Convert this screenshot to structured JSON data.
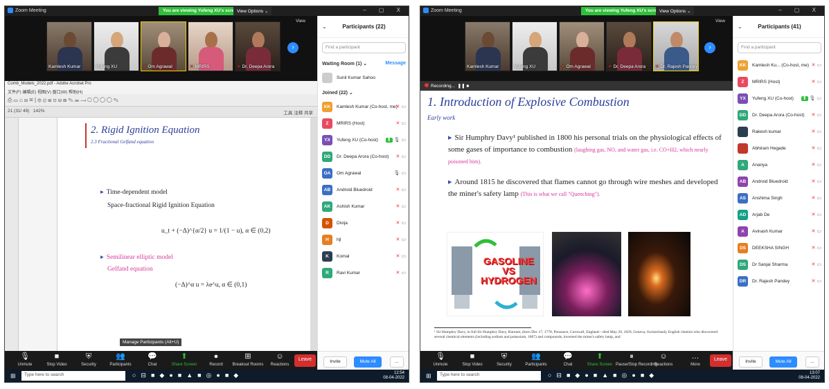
{
  "left": {
    "title": "Zoom Meeting",
    "viewing_banner": "You are viewing Yufeng XU's screen",
    "view_options": "View Options ⌄",
    "view_label": "View",
    "gallery": [
      {
        "name": "Kamlesh Kumar",
        "muted": false
      },
      {
        "name": "Yufeng XU",
        "muted": false
      },
      {
        "name": "Om Agrawal",
        "muted": true
      },
      {
        "name": "MRIRS",
        "muted": true
      },
      {
        "name": "Dr. Deepa Arora",
        "muted": true
      }
    ],
    "acrobat": {
      "title": "Comb_Models_2022.pdf - Adobe Acrobat Pro",
      "menu": "文件(F) 编辑(E) 视图(V) 窗口(W) 帮助(H)",
      "page_status": "21 (31/ 49)",
      "zoom": "142%",
      "right_tools": "工具  注释  共享"
    },
    "document": {
      "heading": "2. Rigid Ignition Equation",
      "subheading": "2.3 Fractional Gelfand equation",
      "bullet1": "Time-dependent model",
      "bullet1_sub": "Space-fractional Rigid Ignition Equation",
      "eq1": "u_t + (−Δ)^{α/2} u = 1/(1 − u),  α ∈ (0,2)",
      "bullet2": "Semilinear elliptic model",
      "bullet2_sub": "Gelfand equation",
      "eq2": "(−Δ)^α u = λe^u,  α ∈ (0,1)"
    },
    "participants": {
      "title": "Participants (22)",
      "search_placeholder": "Find a participant",
      "waiting_header": "Waiting Room (1)  ⌄",
      "waiting_action": "Message",
      "waiting": [
        {
          "initials": "",
          "name": "Sunil Kumar Sahoo",
          "color": "#cccccc"
        }
      ],
      "joined_header": "Joined (22)  ⌄",
      "joined": [
        {
          "initials": "KK",
          "name": "Kamlesh Kumar (Co-host, me)",
          "color": "#f0a030",
          "status": "muted"
        },
        {
          "initials": "Z",
          "name": "MRIRS (Host)",
          "color": "#e84a5f",
          "status": "muted"
        },
        {
          "initials": "YX",
          "name": "Yufeng XU (Co-host)",
          "color": "#7a4fb5",
          "status": "sharing"
        },
        {
          "initials": "DD",
          "name": "Dr. Deepa Arora (Co-host)",
          "color": "#2fa87a",
          "status": "muted"
        },
        {
          "initials": "OA",
          "name": "Om Agrawal",
          "color": "#3a6fc4",
          "status": "unmuted"
        },
        {
          "initials": "AB",
          "name": "Android Bluedroid",
          "color": "#3a6fc4",
          "status": "muted"
        },
        {
          "initials": "AK",
          "name": "Ashish Kumar",
          "color": "#2fa87a",
          "status": "muted"
        },
        {
          "initials": "D",
          "name": "Divija",
          "color": "#d35400",
          "status": "muted"
        },
        {
          "initials": "H",
          "name": "hjl",
          "color": "#e67e22",
          "status": "muted"
        },
        {
          "initials": "K",
          "name": "Komal",
          "color": "#2c3e50",
          "status": "muted"
        },
        {
          "initials": "R",
          "name": "Ravi Kumar",
          "color": "#2fa87a",
          "status": "muted"
        }
      ],
      "invite": "Invite",
      "mute_all": "Mute All",
      "more": "..."
    },
    "tooltip": "Manage Participants (Alt+U)",
    "toolbar": [
      {
        "icon": "🎙",
        "label": "Unmute"
      },
      {
        "icon": "■",
        "label": "Stop Video"
      },
      {
        "icon": "⛨",
        "label": "Security"
      },
      {
        "icon": "👥",
        "label": "Participants"
      },
      {
        "icon": "💬",
        "label": "Chat"
      },
      {
        "icon": "⬆",
        "label": "Share Screen"
      },
      {
        "icon": "●",
        "label": "Record"
      },
      {
        "icon": "⊞",
        "label": "Breakout Rooms"
      },
      {
        "icon": "☺",
        "label": "Reactions"
      }
    ],
    "leave": "Leave",
    "taskbar": {
      "search": "Type here to search",
      "time": "12:54",
      "date": "08-04-2022"
    }
  },
  "right": {
    "title": "Zoom Meeting",
    "viewing_banner": "You are viewing Yufeng XU's screen",
    "view_options": "View Options ⌄",
    "view_label": "View",
    "gallery": [
      {
        "name": "Kamlesh Kumar",
        "muted": false
      },
      {
        "name": "Yufeng XU",
        "muted": false
      },
      {
        "name": "Om Agrawal",
        "muted": true
      },
      {
        "name": "Dr. Deepa Arora",
        "muted": true
      },
      {
        "name": "Dr. Rajesh Pandey",
        "muted": true
      }
    ],
    "recording": "Recording...",
    "slide": {
      "heading": "1. Introduction of Explosive Combustion",
      "subheading": "Early work",
      "b1_main": "Sir Humphry Davy¹ published in 1800 his personal trials on the physiological effects of some gases of importance to combustion",
      "b1_pink": "(laughing gas, NO, and water gas, i.e. CO+H2, which nearly poisoned him).",
      "b2_main": "Around 1815 he discovered that flames cannot go through wire meshes and developed the miner's safety lamp",
      "b2_pink": "(This is what we call \"Quenching\").",
      "gas_top": "GASOLINE",
      "gas_vs": "VS",
      "gas_bottom": "HYDROGEN",
      "footnote": "¹ Sir Humphry Davy, in full Sir Humphry Davy, Baronet, (born Dec 17, 1778, Penzance, Cornwall, England—died May 29, 1829, Geneva, Switzerland), English chemist who discovered several chemical elements (including sodium and potassium, 1807) and compounds, invented the miner's safety lamp, and"
    },
    "participants": {
      "title": "Participants (41)",
      "search_placeholder": "Find a participant",
      "joined": [
        {
          "initials": "KK",
          "name": "Kamlesh Ku... (Co-host, me)",
          "color": "#f0a030",
          "status": "muted"
        },
        {
          "initials": "Z",
          "name": "MRIRS (Host)",
          "color": "#e84a5f",
          "status": "muted"
        },
        {
          "initials": "YX",
          "name": "Yufeng XU (Co-host)",
          "color": "#7a4fb5",
          "status": "sharing"
        },
        {
          "initials": "DD",
          "name": "Dr. Deepa Arora (Co-host)",
          "color": "#2fa87a",
          "status": "muted"
        },
        {
          "initials": "",
          "name": "Rakesh kumar",
          "color": "#2c3e50",
          "status": "muted"
        },
        {
          "initials": "",
          "name": "Abhiram Hegade",
          "color": "#c0392b",
          "status": "muted"
        },
        {
          "initials": "A",
          "name": "Ananya",
          "color": "#2fa87a",
          "status": "muted"
        },
        {
          "initials": "AB",
          "name": "Android Bluedroid",
          "color": "#8e44ad",
          "status": "muted"
        },
        {
          "initials": "AS",
          "name": "Anshima Singh",
          "color": "#3a6fc4",
          "status": "muted"
        },
        {
          "initials": "AD",
          "name": "Arjab De",
          "color": "#16a085",
          "status": "muted"
        },
        {
          "initials": "A",
          "name": "Avinash Kumar",
          "color": "#8e44ad",
          "status": "muted"
        },
        {
          "initials": "DS",
          "name": "DEEKSHA SINGH",
          "color": "#e67e22",
          "status": "muted"
        },
        {
          "initials": "DS",
          "name": "Dr Sanjai Sharma",
          "color": "#2fa87a",
          "status": "muted"
        },
        {
          "initials": "DR",
          "name": "Dr. Rajesh Pandey",
          "color": "#3a6fc4",
          "status": "muted"
        }
      ],
      "invite": "Invite",
      "mute_all": "Mute All",
      "more": "..."
    },
    "toolbar": [
      {
        "icon": "🎙",
        "label": "Unmute"
      },
      {
        "icon": "■",
        "label": "Stop Video"
      },
      {
        "icon": "⛨",
        "label": "Security"
      },
      {
        "icon": "👥",
        "label": "Participants"
      },
      {
        "icon": "💬",
        "label": "Chat"
      },
      {
        "icon": "⬆",
        "label": "Share Screen"
      },
      {
        "icon": "⏸",
        "label": "Pause/Stop Recording"
      },
      {
        "icon": "☺",
        "label": "Reactions"
      },
      {
        "icon": "…",
        "label": "More"
      }
    ],
    "leave": "Leave",
    "taskbar": {
      "search": "Type here to search",
      "time": "13:07",
      "date": "08-04-2022"
    }
  }
}
